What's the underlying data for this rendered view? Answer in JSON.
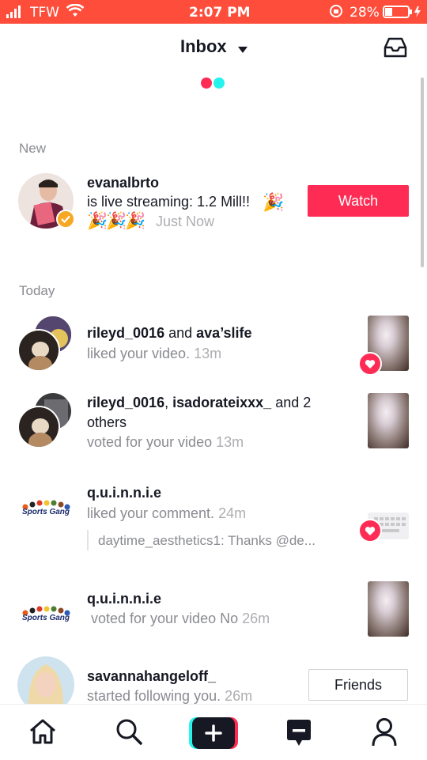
{
  "status_bar": {
    "carrier": "TFW",
    "time": "2:07 PM",
    "battery": "28%"
  },
  "header": {
    "title": "Inbox"
  },
  "sections": {
    "new": "New",
    "today": "Today"
  },
  "live": {
    "username": "evanalbrto",
    "text": "is live streaming: 1.2 Mill!!",
    "time": "Just Now",
    "button": "Watch"
  },
  "notifications": [
    {
      "user": "rileyd_0016",
      "joiner": "and",
      "user2": "ava’slife",
      "action": "liked your video.",
      "time": "13m"
    },
    {
      "user": "rileyd_0016",
      "joiner": ",",
      "user2": "isadorateixxx_",
      "tail": "and 2",
      "tail2": "others",
      "action": "voted for your video",
      "time": "13m"
    },
    {
      "user": "q.u.i.n.n.i.e",
      "action": "liked your comment.",
      "time": "24m",
      "quote": "daytime_aesthetics1: Thanks @de..."
    },
    {
      "user": "q.u.i.n.n.i.e",
      "action": "voted for your video No",
      "time": "26m"
    },
    {
      "user": "savannahangeloff_",
      "action": "started following you.",
      "time": "26m",
      "button": "Friends"
    }
  ],
  "avatar_text": {
    "sports_gang": "Sports Gang"
  },
  "colors": {
    "status_bar": "#ff4d3b",
    "accent": "#fe2c55",
    "cyan": "#25f4ee"
  },
  "tabbar": {
    "items": [
      "home-icon",
      "search-icon",
      "create-icon",
      "inbox-icon",
      "profile-icon"
    ]
  }
}
